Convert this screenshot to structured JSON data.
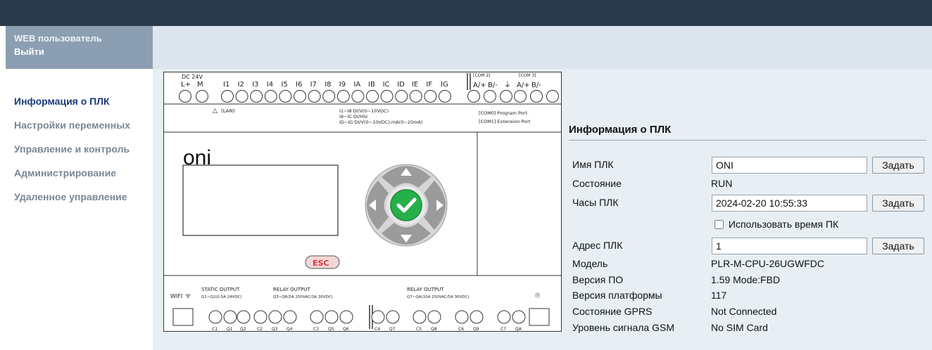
{
  "user": {
    "title": "WEB пользователь",
    "logout": "Выйти"
  },
  "sidebar": {
    "items": [
      {
        "label": "Информация о ПЛК",
        "active": true
      },
      {
        "label": "Настройки переменных",
        "active": false
      },
      {
        "label": "Управление и контроль",
        "active": false
      },
      {
        "label": "Администрирование",
        "active": false
      },
      {
        "label": "Удаленное управление",
        "active": false
      }
    ]
  },
  "plc_image": {
    "power_label": "DC 24V",
    "power_terminals": [
      "L+",
      "M"
    ],
    "inputs": [
      "I1",
      "I2",
      "I3",
      "I4",
      "I5",
      "I6",
      "I7",
      "I8",
      "I9",
      "IA",
      "IB",
      "IC",
      "ID",
      "IE",
      "IF",
      "IG"
    ],
    "com2_label": "[COM 2]",
    "com3_label": "[COM 3]",
    "com2_terminals": [
      "A/+",
      "B/-"
    ],
    "com3_terminals": [
      "A/+",
      "B/-"
    ],
    "lan_label": "(LAN)",
    "spec_lines": [
      "I1~I8 DI/V(0~10VDC)",
      "I9~IC DI/HSI",
      "ID~IG DI/V(0~10VDC),mA(0~20mA)"
    ],
    "port_lines": [
      "[COM0] Program Port",
      "[COM1] Extension Port"
    ],
    "brand": "oni",
    "esc_label": "ESC",
    "wifi_label": "WIFI",
    "out_groups": [
      {
        "title": "STATIC OUTPUT",
        "spec": "Q1~Q2(0.5A 24VDC)"
      },
      {
        "title": "RELAY OUTPUT",
        "spec": "Q3~Q6(5A 250VAC/3A 30VDC)"
      },
      {
        "title": "RELAY OUTPUT",
        "spec": "Q7~QA(10A 250VAC/5A 30VDC)"
      }
    ],
    "bottom_terminals": [
      "C1",
      "Q1",
      "Q2",
      "C2",
      "Q3",
      "Q4",
      "C3",
      "Q5",
      "Q6",
      "C4",
      "Q7",
      "C5",
      "Q8",
      "C6",
      "Q9",
      "C7",
      "QA"
    ]
  },
  "info": {
    "title": "Информация о ПЛК",
    "set_label": "Задать",
    "plc_name": {
      "label": "Имя ПЛК",
      "value": "ONI"
    },
    "state": {
      "label": "Состояние",
      "value": "RUN"
    },
    "clock": {
      "label": "Часы ПЛК",
      "value": "2024-02-20 10:55:33"
    },
    "use_pc_time": {
      "label": "Использовать время ПК",
      "checked": false
    },
    "address": {
      "label": "Адрес ПЛК",
      "value": "1"
    },
    "model": {
      "label": "Модель",
      "value": "PLR-M-CPU-26UGWFDC"
    },
    "firmware": {
      "label": "Версия ПО",
      "value": "1.59 Mode:FBD"
    },
    "platform": {
      "label": "Версия платформы",
      "value": "117"
    },
    "gprs": {
      "label": "Состояние GPRS",
      "value": "Not Connected"
    },
    "gsm": {
      "label": "Уровень сигнала GSM",
      "value": "No SIM Card"
    }
  },
  "colors": {
    "topbar": "#2b3a4a",
    "user_box": "#8c9fb2",
    "content_bg": "#e7eef4",
    "active_menu": "#1b3a78",
    "inactive_menu": "#7a8794",
    "keypad_green": "#27b04a",
    "esc_red": "#d8383a"
  }
}
